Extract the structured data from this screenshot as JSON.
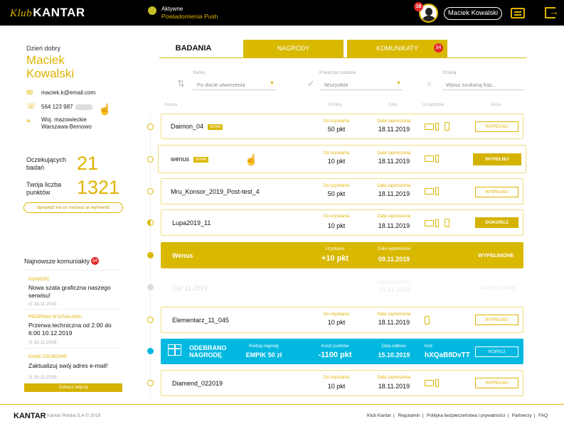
{
  "header": {
    "logo_klub": "Klub",
    "logo_brand": "KANTAR",
    "push_line1": "Aktywne",
    "push_line2": "Powiadomienia Push",
    "notifications_count": "16",
    "user_button": "Maciek Kowalski"
  },
  "profile": {
    "greeting": "Dzień dobry",
    "first_name": "Maciek",
    "last_name": "Kowalski",
    "email": "maciek.k@email.com",
    "phone": "564 123 987",
    "region_line1": "Woj. mazowieckie",
    "region_line2": "Warszawa-Bemowo"
  },
  "stats": {
    "pending_label_1": "Oczekujących",
    "pending_label_2": "badań",
    "pending_value": "21",
    "points_label_1": "Twoja liczba",
    "points_label_2": "punktów",
    "points_value": "1321",
    "check_link": "Sprawdź na co możesz je wymienić"
  },
  "news": {
    "title": "Najnowsze komuniakty",
    "count": "34",
    "items": [
      {
        "category": "Nowość",
        "text": "Nowa szata graficzna naszego serwisu!",
        "date": "18.11.2019"
      },
      {
        "category": "Przerwa w działaniu",
        "text": "Przerwa techniczna od 2:00 do 6:00 10.12.2019",
        "date": "18.11.2019"
      },
      {
        "category": "Dane osobowe",
        "text": "Zaktualizuj swój adres e-mail!",
        "date": "18.11.2019"
      }
    ],
    "more_button": "Zobacz więcej"
  },
  "tabs": {
    "badania": "BADANIA",
    "nagrody": "NAGRODY",
    "komunikaty": "KOMUNIKATY",
    "komunikaty_count": "34"
  },
  "filters": {
    "sort_label": "Sortuj",
    "sort_value": "Po dacie utworzenia",
    "status_label": "Pokaż po statusie",
    "status_value": "Wszystkie",
    "search_label": "Szukaj",
    "search_placeholder": "Wpisz szukaną fraz..."
  },
  "columns": {
    "name": "Nazwa",
    "points": "Punkty",
    "date": "Data",
    "device": "Urządzenia",
    "action": "Akcja"
  },
  "surveys": [
    {
      "name": "Daimon_04",
      "badge": "NOWA",
      "points_label": "Do uzyskania",
      "points": "50 pkt",
      "date_label": "Data zaproszenia",
      "date": "18.11.2019",
      "action": "WYPEŁNIJ"
    },
    {
      "name": "wenus",
      "badge": "NOWA",
      "points_label": "Do uzyskania",
      "points": "10 pkt",
      "date_label": "Data zaproszenia",
      "date": "18.11.2019",
      "action": "WYPEŁNIJ"
    },
    {
      "name": "Mru_Konsor_2019_Post-test_4",
      "points_label": "Do uzyskania",
      "points": "50 pkt",
      "date_label": "Data zaproszenia",
      "date": "18.11.2019",
      "action": "WYPEŁNIJ"
    },
    {
      "name": "Lupa2019_11",
      "points_label": "Do uzyskania",
      "points": "10 pkt",
      "date_label": "Data zaproszenia",
      "date": "18.11.2019",
      "action": "DOKOŃCZ"
    },
    {
      "name": "Wenus",
      "points_label": "Uzyskano",
      "points": "+10 pkt",
      "date_label": "Data wypełnienia",
      "date": "09.11.2019",
      "action": "WYPEŁNIONE"
    },
    {
      "name": "TGI 11.2019",
      "date_label": "Data zakończenia",
      "date": "18.11.2019",
      "action": "ZAKOŃCZONE"
    },
    {
      "name": "Elementarz_11_045",
      "points_label": "Do uzyskania",
      "points": "10 pkt",
      "date_label": "Data zaproszenia",
      "date": "18.11.2019",
      "action": "WYPEŁNIJ"
    },
    {
      "name": "Diamend_022019",
      "points_label": "Do uzyskania",
      "points": "10 pkt",
      "date_label": "Data zaproszenia",
      "date": "18.11.2019",
      "action": "WYPEŁNIJ"
    }
  ],
  "reward": {
    "title1": "ODEBRANO",
    "title2": "NAGRODĘ",
    "type_label": "Rodzaj nagrody",
    "type": "EMPIK 50 zł",
    "cost_label": "Koszt punktów",
    "cost": "-1100 pkt",
    "date_label": "Data odbioru",
    "date": "15.10.2019",
    "code_label": "Kod",
    "code": "hXQaB8DvTT",
    "copy_button": "KOPIUJ"
  },
  "footer": {
    "logo": "KANTAR",
    "copyright": "Kantar Polska S.A © 2019",
    "links": [
      "Klub Kantar",
      "Regulamin",
      "Polityka bezpieczeństwa i prywatności",
      "Partnerzy",
      "FAQ"
    ]
  },
  "colors": {
    "gold": "#d9b800",
    "blue": "#00b8e0",
    "red": "#e42b2b"
  }
}
